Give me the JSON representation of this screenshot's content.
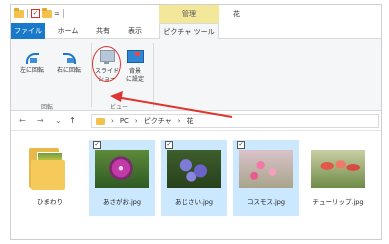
{
  "titlebar": {
    "qa_eq": "=",
    "qa_check": "✓",
    "tool_tab": "管理",
    "window_title": "花"
  },
  "tabs": {
    "file": "ファイル",
    "home": "ホーム",
    "share": "共有",
    "view": "表示",
    "picture_tools": "ピクチャ ツール"
  },
  "ribbon": {
    "rotate_left": "左に回転",
    "rotate_right": "右に回転",
    "slideshow_1": "スライド",
    "slideshow_2": "ショー",
    "background_1": "背景",
    "background_2": "に設定",
    "group_rotate": "回転",
    "group_view": "ビュー"
  },
  "nav": {
    "back": "←",
    "forward": "→",
    "dropdown": "⌄",
    "up": "↑",
    "path": [
      "PC",
      "ピクチャ",
      "花"
    ],
    "sep": "›"
  },
  "files": [
    {
      "name": "ひまわり",
      "selected": false
    },
    {
      "name": "あさがお.jpg",
      "selected": true
    },
    {
      "name": "あじさい.jpg",
      "selected": true
    },
    {
      "name": "コスモス.jpg",
      "selected": true
    },
    {
      "name": "チューリップ.jpg",
      "selected": false
    }
  ],
  "annotation_color": "#e0342f",
  "accent_color": "#1979ca"
}
